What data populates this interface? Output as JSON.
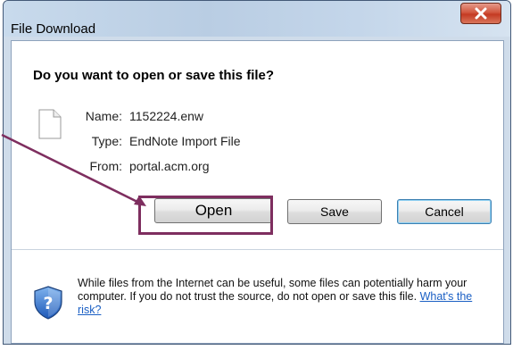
{
  "window": {
    "title": "File Download"
  },
  "dialog": {
    "question": "Do you want to open or save this file?",
    "file": {
      "name_label": "Name:",
      "name_value": "1152224.enw",
      "type_label": "Type:",
      "type_value": "EndNote Import File",
      "from_label": "From:",
      "from_value": "portal.acm.org"
    },
    "buttons": {
      "open": "Open",
      "save": "Save",
      "cancel": "Cancel"
    },
    "warning": {
      "text": "While files from the Internet can be useful, some files can potentially harm your computer. If you do not trust the source, do not open or save this file.",
      "link": "What's the risk?"
    }
  },
  "annotation": {
    "color": "#7e2e5f"
  },
  "icons": {
    "close": "close-icon",
    "file": "file-icon",
    "security": "shield-question-icon"
  }
}
